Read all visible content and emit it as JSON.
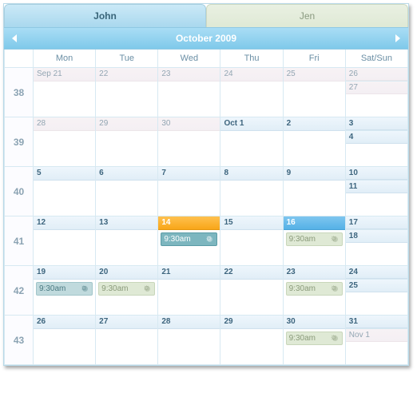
{
  "tabs": [
    {
      "label": "John",
      "active": true
    },
    {
      "label": "Jen",
      "active": false
    }
  ],
  "header": {
    "title": "October 2009"
  },
  "dayHeaders": [
    "Mon",
    "Tue",
    "Wed",
    "Thu",
    "Fri",
    "Sat/Sun"
  ],
  "weeks": [
    {
      "num": "38",
      "days": [
        {
          "label": "Sep 21",
          "in": false
        },
        {
          "label": "22",
          "in": false
        },
        {
          "label": "23",
          "in": false
        },
        {
          "label": "24",
          "in": false
        },
        {
          "label": "25",
          "in": false
        }
      ],
      "sat": {
        "label": "26",
        "in": false
      },
      "sun": {
        "label": "27",
        "in": false
      }
    },
    {
      "num": "39",
      "days": [
        {
          "label": "28",
          "in": false
        },
        {
          "label": "29",
          "in": false
        },
        {
          "label": "30",
          "in": false
        },
        {
          "label": "Oct 1",
          "in": true
        },
        {
          "label": "2",
          "in": true
        }
      ],
      "sat": {
        "label": "3",
        "in": true
      },
      "sun": {
        "label": "4",
        "in": true
      }
    },
    {
      "num": "40",
      "days": [
        {
          "label": "5",
          "in": true
        },
        {
          "label": "6",
          "in": true
        },
        {
          "label": "7",
          "in": true
        },
        {
          "label": "8",
          "in": true
        },
        {
          "label": "9",
          "in": true
        }
      ],
      "sat": {
        "label": "10",
        "in": true
      },
      "sun": {
        "label": "11",
        "in": true
      }
    },
    {
      "num": "41",
      "days": [
        {
          "label": "12",
          "in": true
        },
        {
          "label": "13",
          "in": true
        },
        {
          "label": "14",
          "in": true,
          "today": true,
          "events": [
            {
              "time": "9:30am",
              "owner": "john"
            }
          ]
        },
        {
          "label": "15",
          "in": true
        },
        {
          "label": "16",
          "in": true,
          "selected": true,
          "events": [
            {
              "time": "9:30am",
              "owner": "jen"
            }
          ]
        }
      ],
      "sat": {
        "label": "17",
        "in": true
      },
      "sun": {
        "label": "18",
        "in": true
      }
    },
    {
      "num": "42",
      "days": [
        {
          "label": "19",
          "in": true,
          "events": [
            {
              "time": "9:30am",
              "owner": "john",
              "style": "light"
            }
          ]
        },
        {
          "label": "20",
          "in": true,
          "events": [
            {
              "time": "9:30am",
              "owner": "jen"
            }
          ]
        },
        {
          "label": "21",
          "in": true
        },
        {
          "label": "22",
          "in": true
        },
        {
          "label": "23",
          "in": true,
          "events": [
            {
              "time": "9:30am",
              "owner": "jen"
            }
          ]
        }
      ],
      "sat": {
        "label": "24",
        "in": true
      },
      "sun": {
        "label": "25",
        "in": true
      }
    },
    {
      "num": "43",
      "days": [
        {
          "label": "26",
          "in": true
        },
        {
          "label": "27",
          "in": true
        },
        {
          "label": "28",
          "in": true
        },
        {
          "label": "29",
          "in": true
        },
        {
          "label": "30",
          "in": true,
          "events": [
            {
              "time": "9:30am",
              "owner": "jen"
            }
          ]
        }
      ],
      "sat": {
        "label": "31",
        "in": true
      },
      "sun": {
        "label": "Nov 1",
        "in": false
      }
    }
  ]
}
